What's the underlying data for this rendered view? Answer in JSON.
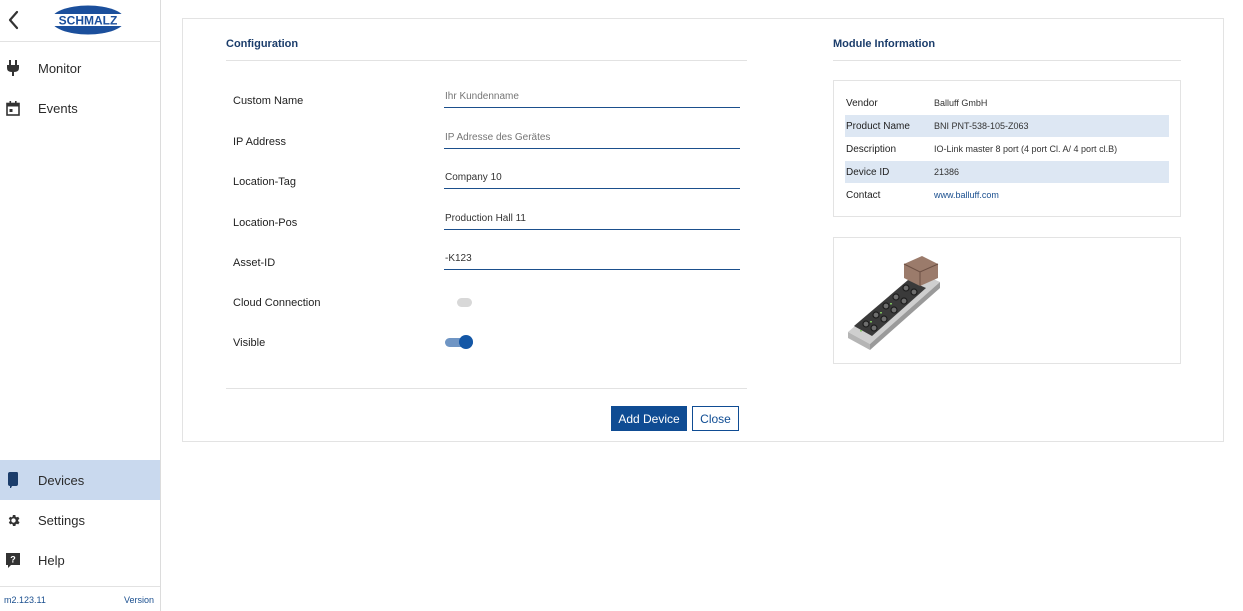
{
  "brand": {
    "logo_text": "SCHMALZ",
    "color": "#1b4f9c"
  },
  "sidebar": {
    "items": [
      {
        "label": "Monitor",
        "icon": "plug-icon"
      },
      {
        "label": "Events",
        "icon": "calendar-icon"
      },
      {
        "label": "Devices",
        "icon": "device-icon",
        "active": true
      },
      {
        "label": "Settings",
        "icon": "gear-icon"
      },
      {
        "label": "Help",
        "icon": "help-icon"
      }
    ],
    "version_number": "m2.123.11",
    "version_label": "Version"
  },
  "config": {
    "title": "Configuration",
    "fields": [
      {
        "label": "Custom Name",
        "placeholder": "Ihr Kundenname",
        "value": ""
      },
      {
        "label": "IP Address",
        "placeholder": "IP Adresse des Gerätes",
        "value": ""
      },
      {
        "label": "Location-Tag",
        "placeholder": "",
        "value": "Company 10"
      },
      {
        "label": "Location-Pos",
        "placeholder": "",
        "value": "Production Hall 11"
      },
      {
        "label": "Asset-ID",
        "placeholder": "",
        "value": "-K123"
      }
    ],
    "cloud_label": "Cloud Connection",
    "cloud_on": false,
    "visible_label": "Visible",
    "visible_on": true,
    "add_button": "Add Device",
    "close_button": "Close"
  },
  "module": {
    "title": "Module Information",
    "rows": [
      {
        "key": "Vendor",
        "value": "Balluff GmbH"
      },
      {
        "key": "Product Name",
        "value": "BNI PNT-538-105-Z063"
      },
      {
        "key": "Description",
        "value": "IO-Link master 8 port (4 port Cl. A/ 4 port cl.B)"
      },
      {
        "key": "Device ID",
        "value": "21386"
      },
      {
        "key": "Contact",
        "value": "www.balluff.com"
      }
    ]
  },
  "colors": {
    "accent": "#0f4c93",
    "active_bg": "#c9d9ee",
    "row_shade": "#dde7f3"
  }
}
